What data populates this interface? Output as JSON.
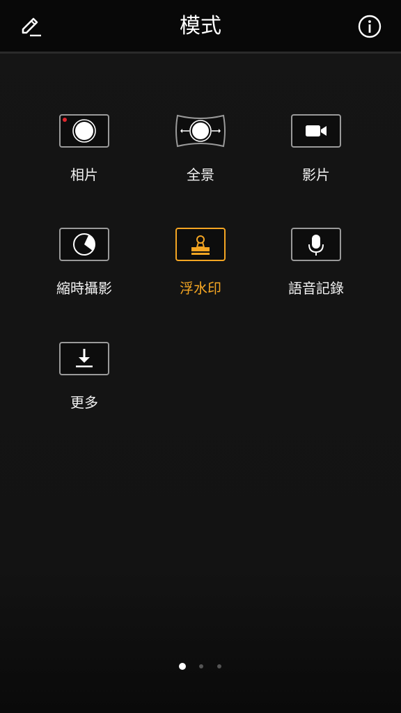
{
  "header": {
    "title": "模式",
    "edit_icon": "pencil-edit-icon",
    "info_icon": "info-circle-icon"
  },
  "modes": [
    {
      "label": "相片",
      "icon": "camera-shutter-icon",
      "active": false
    },
    {
      "label": "全景",
      "icon": "panorama-icon",
      "active": false
    },
    {
      "label": "影片",
      "icon": "video-camera-icon",
      "active": false
    },
    {
      "label": "縮時攝影",
      "icon": "timelapse-icon",
      "active": false
    },
    {
      "label": "浮水印",
      "icon": "stamp-icon",
      "active": true
    },
    {
      "label": "語音記錄",
      "icon": "microphone-icon",
      "active": false
    },
    {
      "label": "更多",
      "icon": "download-icon",
      "active": false
    }
  ],
  "pagination": {
    "pages": 3,
    "current": 1
  },
  "colors": {
    "accent": "#f5a623",
    "record_dot": "#e0262d",
    "tile_border": "#9a9a9a",
    "text": "#f2f2f2"
  }
}
